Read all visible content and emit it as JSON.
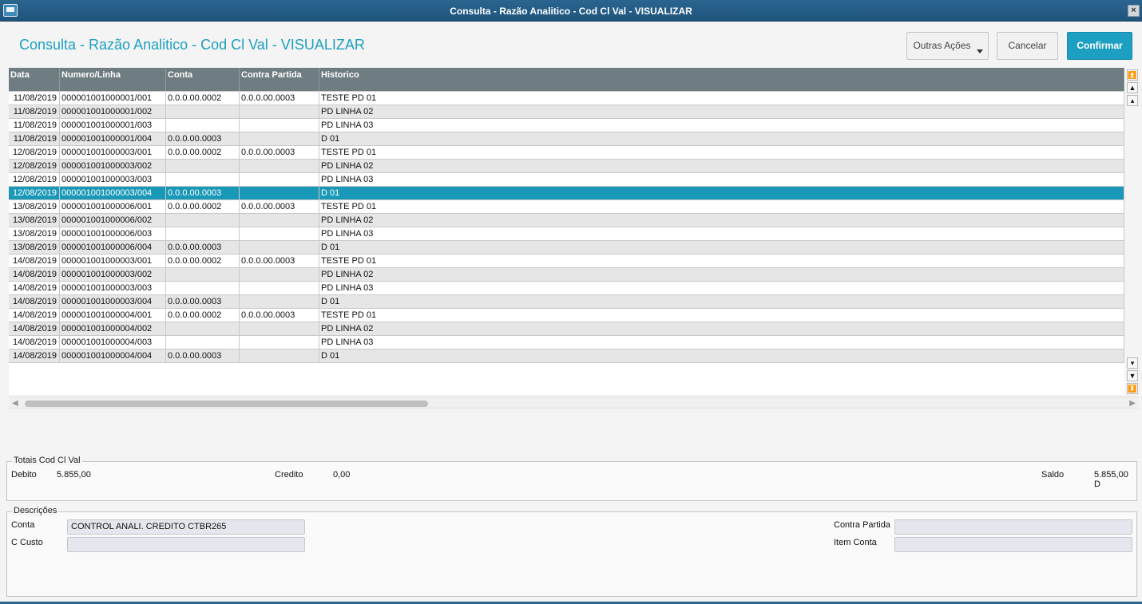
{
  "window": {
    "title": "Consulta - Razão Analitico - Cod Cl Val - VISUALIZAR",
    "close_label": "×"
  },
  "header": {
    "title": "Consulta - Razão Analitico - Cod Cl Val - VISUALIZAR",
    "outras_label": "Outras Ações",
    "cancel_label": "Cancelar",
    "confirm_label": "Confirmar"
  },
  "grid": {
    "columns": [
      "Data",
      "Numero/Linha",
      "Conta",
      "Contra Partida",
      "Historico"
    ],
    "selected_index": 7,
    "rows": [
      [
        "11/08/2019",
        "000001001000001/001",
        "0.0.0.00.0002",
        "0.0.0.00.0003",
        "TESTE PD 01"
      ],
      [
        "11/08/2019",
        "000001001000001/002",
        "",
        "",
        "PD LINHA 02"
      ],
      [
        "11/08/2019",
        "000001001000001/003",
        "",
        "",
        "PD LINHA 03"
      ],
      [
        "11/08/2019",
        "000001001000001/004",
        "0.0.0.00.0003",
        "",
        "D 01"
      ],
      [
        "12/08/2019",
        "000001001000003/001",
        "0.0.0.00.0002",
        "0.0.0.00.0003",
        "TESTE PD 01"
      ],
      [
        "12/08/2019",
        "000001001000003/002",
        "",
        "",
        "PD LINHA 02"
      ],
      [
        "12/08/2019",
        "000001001000003/003",
        "",
        "",
        "PD LINHA 03"
      ],
      [
        "12/08/2019",
        "000001001000003/004",
        "0.0.0.00.0003",
        "",
        "D 01"
      ],
      [
        "13/08/2019",
        "000001001000006/001",
        "0.0.0.00.0002",
        "0.0.0.00.0003",
        "TESTE PD 01"
      ],
      [
        "13/08/2019",
        "000001001000006/002",
        "",
        "",
        "PD LINHA 02"
      ],
      [
        "13/08/2019",
        "000001001000006/003",
        "",
        "",
        "PD LINHA 03"
      ],
      [
        "13/08/2019",
        "000001001000006/004",
        "0.0.0.00.0003",
        "",
        "D 01"
      ],
      [
        "14/08/2019",
        "000001001000003/001",
        "0.0.0.00.0002",
        "0.0.0.00.0003",
        "TESTE PD 01"
      ],
      [
        "14/08/2019",
        "000001001000003/002",
        "",
        "",
        "PD LINHA 02"
      ],
      [
        "14/08/2019",
        "000001001000003/003",
        "",
        "",
        "PD LINHA 03"
      ],
      [
        "14/08/2019",
        "000001001000003/004",
        "0.0.0.00.0003",
        "",
        "D 01"
      ],
      [
        "14/08/2019",
        "000001001000004/001",
        "0.0.0.00.0002",
        "0.0.0.00.0003",
        "TESTE PD 01"
      ],
      [
        "14/08/2019",
        "000001001000004/002",
        "",
        "",
        "PD LINHA 02"
      ],
      [
        "14/08/2019",
        "000001001000004/003",
        "",
        "",
        "PD LINHA 03"
      ],
      [
        "14/08/2019",
        "000001001000004/004",
        "0.0.0.00.0003",
        "",
        "D 01"
      ]
    ]
  },
  "totals": {
    "legend": "Totais Cod Cl Val",
    "debito_label": "Debito",
    "debito_value": "5.855,00",
    "credito_label": "Credito",
    "credito_value": "0,00",
    "saldo_label": "Saldo",
    "saldo_value": "5.855,00 D"
  },
  "descricoes": {
    "legend": "Descrições",
    "conta_label": "Conta",
    "conta_value": "CONTROL ANALI. CREDITO CTBR265",
    "ccusto_label": "C Custo",
    "ccusto_value": "",
    "contra_partida_label": "Contra Partida",
    "contra_partida_value": "",
    "item_conta_label": "Item Conta",
    "item_conta_value": ""
  },
  "colors": {
    "accent": "#1d9fc2",
    "titlebar": "#2a6590",
    "grid_header": "#6f7c81",
    "selected_row": "#1a98b8"
  }
}
